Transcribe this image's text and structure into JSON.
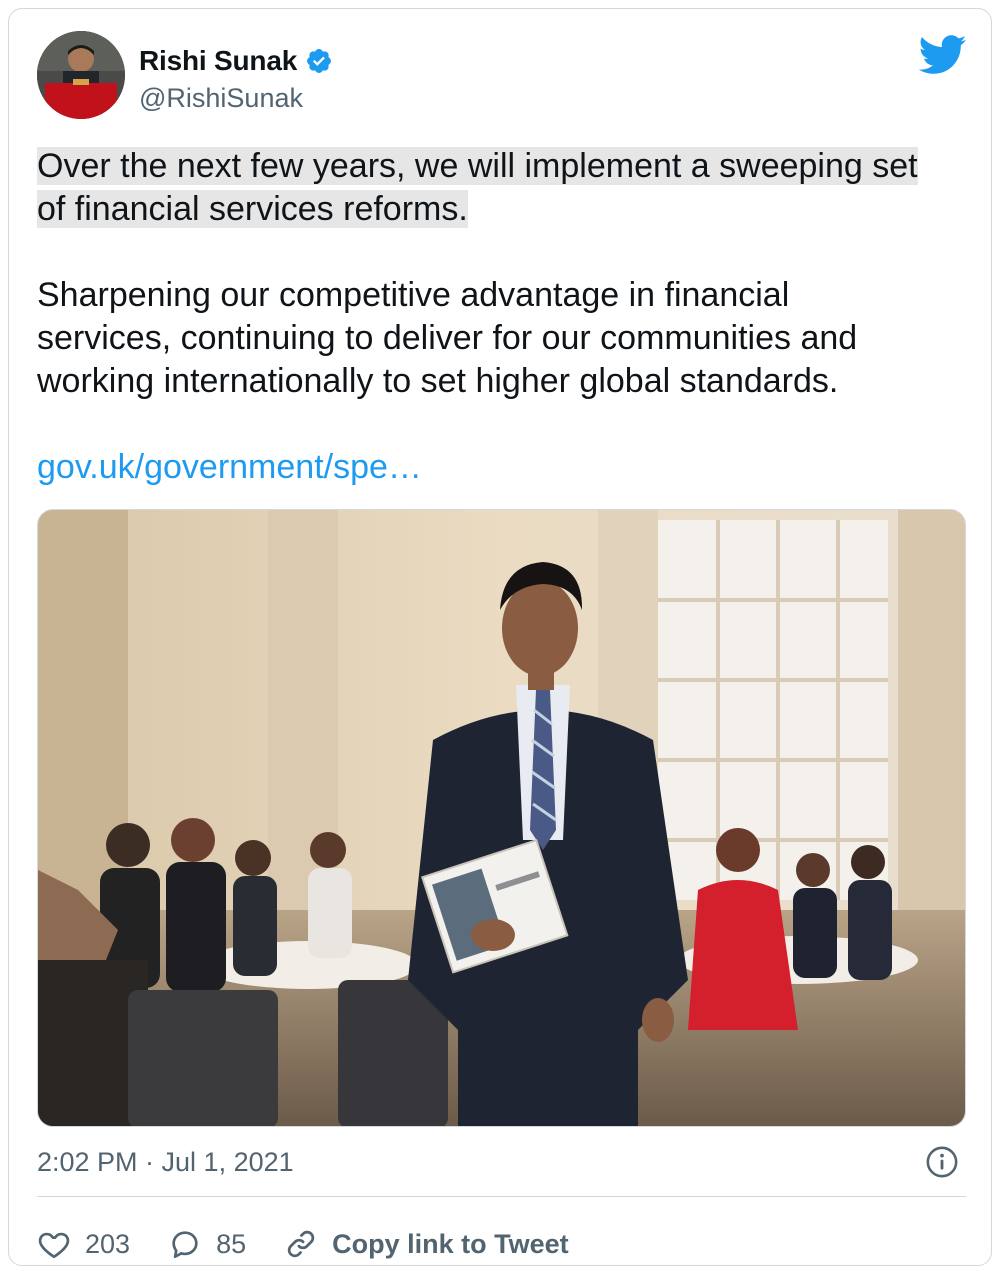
{
  "tweet": {
    "author": {
      "name": "Rishi Sunak",
      "handle": "@RishiSunak",
      "verified": true,
      "avatar_icon": "avatar"
    },
    "text": {
      "highlighted_line1": "Over the next few years, we will implement a sweeping set",
      "highlighted_line2": "of financial services reforms.",
      "paragraph2_line1": "Sharpening our competitive advantage in financial",
      "paragraph2_line2": "services, continuing to deliver for our communities and",
      "paragraph2_line3": "working internationally to set higher global standards.",
      "link": "gov.uk/government/spe…"
    },
    "timestamp": "2:02 PM · Jul 1, 2021",
    "actions": {
      "likes": "203",
      "replies": "85",
      "copy_link": "Copy link to Tweet"
    }
  },
  "colors": {
    "accent": "#1d9bf0",
    "text": "#0f1419",
    "secondary": "#536471",
    "highlight": "#e6e6e6"
  },
  "icons": [
    "twitter-bird-icon",
    "verified-badge-icon",
    "info-icon",
    "heart-icon",
    "reply-icon",
    "link-icon"
  ]
}
